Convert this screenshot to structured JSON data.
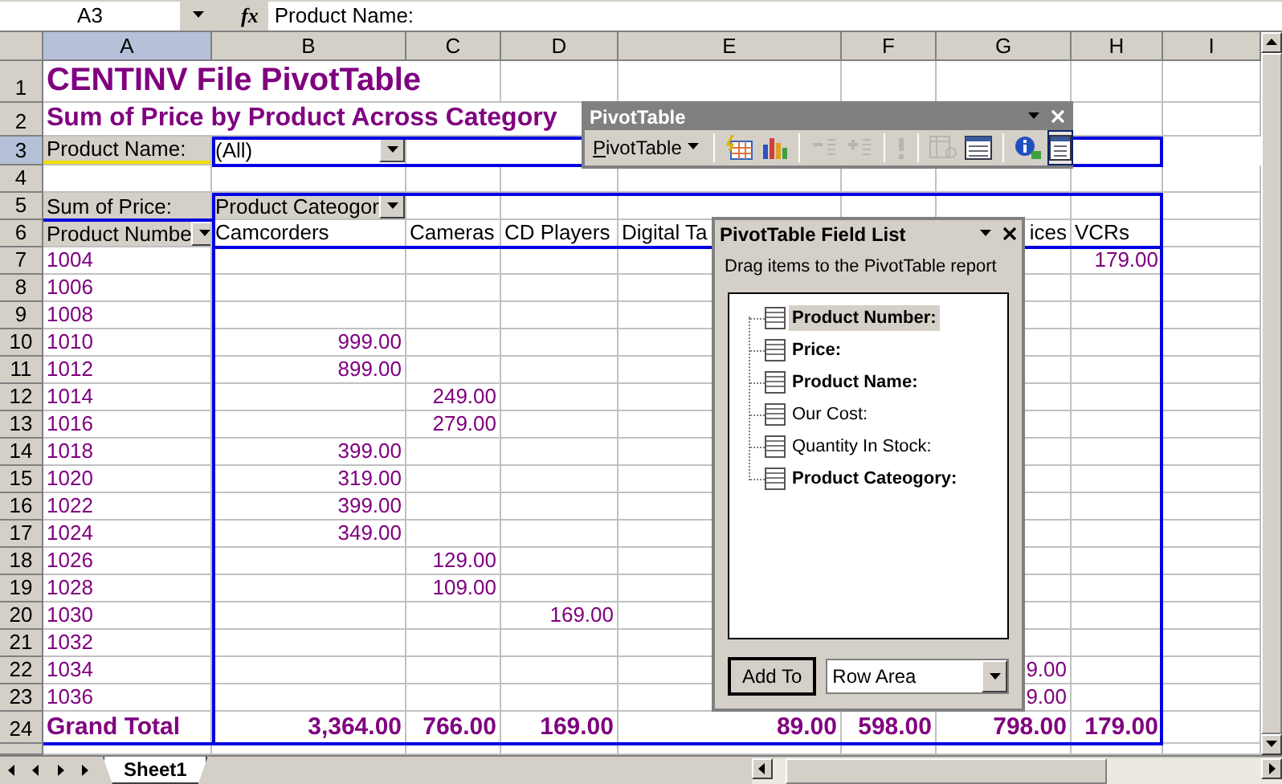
{
  "name_box": "A3",
  "formula_icon": "fx",
  "formula": "Product Name:",
  "columns": [
    {
      "label": "A",
      "selected": true
    },
    {
      "label": "B",
      "selected": false
    },
    {
      "label": "C",
      "selected": false
    },
    {
      "label": "D",
      "selected": false
    },
    {
      "label": "E",
      "selected": false
    },
    {
      "label": "F",
      "selected": false
    },
    {
      "label": "G",
      "selected": false
    },
    {
      "label": "H",
      "selected": false
    },
    {
      "label": "I",
      "selected": false
    }
  ],
  "rows": [
    {
      "number": "1",
      "kind": "title",
      "selected": false,
      "cells": {
        "a": "CENTINV File PivotTable"
      }
    },
    {
      "number": "2",
      "kind": "subtitle",
      "selected": false,
      "cells": {
        "a": "Sum of Price by Product Across Category"
      }
    },
    {
      "number": "3",
      "kind": "page-field",
      "selected": true,
      "cells": {
        "a": "Product Name:",
        "b": "(All)"
      }
    },
    {
      "number": "4",
      "kind": "data",
      "selected": false,
      "cells": {}
    },
    {
      "number": "5",
      "kind": "data-field",
      "selected": false,
      "cells": {
        "a": "Sum of Price:",
        "b": "Product Cateogor"
      }
    },
    {
      "number": "6",
      "kind": "header",
      "selected": false,
      "cells": {
        "a": "Product Numbe",
        "b": "Camcorders",
        "c": "Cameras",
        "d": "CD Players",
        "e": "Digital Ta",
        "g": {
          "text": "ices",
          "clipped": true
        },
        "h": "VCRs"
      }
    },
    {
      "number": "7",
      "kind": "data",
      "selected": false,
      "cells": {
        "a": "1004",
        "h": "179.00"
      }
    },
    {
      "number": "8",
      "kind": "data",
      "selected": false,
      "cells": {
        "a": "1006"
      }
    },
    {
      "number": "9",
      "kind": "data",
      "selected": false,
      "cells": {
        "a": "1008"
      }
    },
    {
      "number": "10",
      "kind": "data",
      "selected": false,
      "cells": {
        "a": "1010",
        "b": "999.00"
      }
    },
    {
      "number": "11",
      "kind": "data",
      "selected": false,
      "cells": {
        "a": "1012",
        "b": "899.00"
      }
    },
    {
      "number": "12",
      "kind": "data",
      "selected": false,
      "cells": {
        "a": "1014",
        "c": "249.00"
      }
    },
    {
      "number": "13",
      "kind": "data",
      "selected": false,
      "cells": {
        "a": "1016",
        "c": "279.00"
      }
    },
    {
      "number": "14",
      "kind": "data",
      "selected": false,
      "cells": {
        "a": "1018",
        "b": "399.00"
      }
    },
    {
      "number": "15",
      "kind": "data",
      "selected": false,
      "cells": {
        "a": "1020",
        "b": "319.00"
      }
    },
    {
      "number": "16",
      "kind": "data",
      "selected": false,
      "cells": {
        "a": "1022",
        "b": "399.00"
      }
    },
    {
      "number": "17",
      "kind": "data",
      "selected": false,
      "cells": {
        "a": "1024",
        "b": "349.00"
      }
    },
    {
      "number": "18",
      "kind": "data",
      "selected": false,
      "cells": {
        "a": "1026",
        "c": "129.00"
      }
    },
    {
      "number": "19",
      "kind": "data",
      "selected": false,
      "cells": {
        "a": "1028",
        "c": "109.00"
      }
    },
    {
      "number": "20",
      "kind": "data",
      "selected": false,
      "cells": {
        "a": "1030",
        "d": "169.00"
      }
    },
    {
      "number": "21",
      "kind": "data",
      "selected": false,
      "cells": {
        "a": "1032"
      }
    },
    {
      "number": "22",
      "kind": "data",
      "selected": false,
      "cells": {
        "a": "1034",
        "g": "9.00"
      }
    },
    {
      "number": "23",
      "kind": "data",
      "selected": false,
      "cells": {
        "a": "1036",
        "g": "9.00"
      }
    },
    {
      "number": "24",
      "kind": "total",
      "selected": false,
      "cells": {
        "a": "Grand Total",
        "b": "3,364.00",
        "c": "766.00",
        "d": "169.00",
        "e": "89.00",
        "f": "598.00",
        "g": "798.00",
        "h": "179.00"
      }
    }
  ],
  "pivot_toolbar": {
    "title": "PivotTable",
    "menu": "PivotTable",
    "buttons": [
      {
        "kind": "format-report",
        "disabled": false,
        "selected": false,
        "separator_before": true
      },
      {
        "kind": "chart",
        "disabled": false,
        "selected": false,
        "separator_before": false
      },
      {
        "kind": "hide-detail",
        "disabled": true,
        "selected": false,
        "separator_before": true
      },
      {
        "kind": "show-detail",
        "disabled": true,
        "selected": false,
        "separator_before": false
      },
      {
        "kind": "refresh",
        "disabled": true,
        "selected": false,
        "separator_before": true
      },
      {
        "kind": "field-settings",
        "disabled": true,
        "selected": false,
        "separator_before": true
      },
      {
        "kind": "table-options",
        "disabled": false,
        "selected": false,
        "separator_before": false
      },
      {
        "kind": "info",
        "disabled": false,
        "selected": false,
        "separator_before": true
      },
      {
        "kind": "field-list",
        "disabled": false,
        "selected": true,
        "separator_before": false
      }
    ]
  },
  "field_list": {
    "title": "PivotTable Field List",
    "hint": "Drag items to the PivotTable report",
    "fields": [
      {
        "label": "Product Number:",
        "used": true,
        "selected": true
      },
      {
        "label": "Price:",
        "used": true,
        "selected": false
      },
      {
        "label": "Product Name:",
        "used": true,
        "selected": false
      },
      {
        "label": "Our Cost:",
        "used": false,
        "selected": false
      },
      {
        "label": "Quantity In Stock:",
        "used": false,
        "selected": false
      },
      {
        "label": "Product Cateogory:",
        "used": true,
        "selected": false
      }
    ],
    "add_button": "Add To",
    "area": "Row Area"
  },
  "sheet_tabs": [
    {
      "label": "Sheet1",
      "selected": true
    }
  ]
}
